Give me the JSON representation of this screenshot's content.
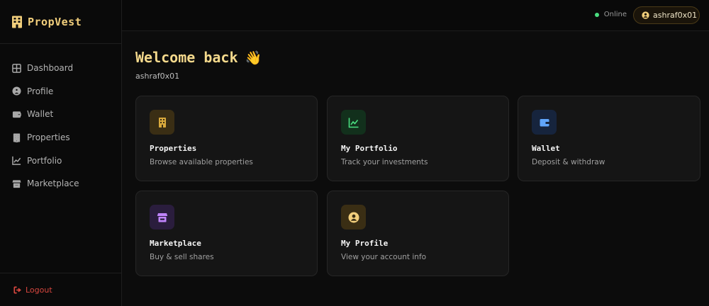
{
  "brand": {
    "name": "PropVest",
    "color": "#f2cf7c"
  },
  "sidebar": {
    "items": [
      {
        "label": "Dashboard",
        "icon": "dashboard-icon"
      },
      {
        "label": "Profile",
        "icon": "user-circle-icon"
      },
      {
        "label": "Wallet",
        "icon": "wallet-icon"
      },
      {
        "label": "Properties",
        "icon": "building-icon"
      },
      {
        "label": "Portfolio",
        "icon": "chart-line-icon"
      },
      {
        "label": "Marketplace",
        "icon": "store-icon"
      }
    ],
    "logout_label": "Logout"
  },
  "topbar": {
    "status_label": "Online",
    "status_color": "#4ade80",
    "user_label": "ashraf0x01"
  },
  "main": {
    "welcome": "Welcome back",
    "wave_emoji": "👋",
    "username": "ashraf0x01",
    "cards": [
      {
        "title": "Properties",
        "subtitle": "Browse available properties",
        "icon": "building-icon",
        "accent": "#d9a93c"
      },
      {
        "title": "My Portfolio",
        "subtitle": "Track your investments",
        "icon": "chart-line-icon",
        "accent": "#4ade80"
      },
      {
        "title": "Wallet",
        "subtitle": "Deposit & withdraw",
        "icon": "wallet-icon",
        "accent": "#60a5fa"
      },
      {
        "title": "Marketplace",
        "subtitle": "Buy & sell shares",
        "icon": "store-icon",
        "accent": "#c084fc"
      },
      {
        "title": "My Profile",
        "subtitle": "View your account info",
        "icon": "user-circle-icon",
        "accent": "#f2cf7c"
      }
    ]
  }
}
